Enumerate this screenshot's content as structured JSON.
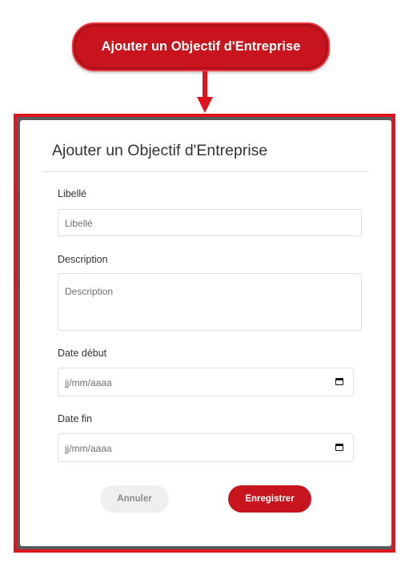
{
  "callout": {
    "label": "Ajouter un Objectif d'Entreprise"
  },
  "modal": {
    "title": "Ajouter un Objectif d'Entreprise",
    "fields": {
      "libelle": {
        "label": "Libellé",
        "placeholder": "Libellé"
      },
      "description": {
        "label": "Description",
        "placeholder": "Description"
      },
      "date_debut": {
        "label": "Date début",
        "value": "jj/mm/aaaa",
        "icon": "calendar-icon"
      },
      "date_fin": {
        "label": "Date fin",
        "value": "jj/mm/aaaa",
        "icon": "calendar-icon"
      }
    },
    "buttons": {
      "cancel": "Annuler",
      "save": "Enregistrer"
    }
  },
  "colors": {
    "accent": "#c8151d",
    "highlight": "#e0141e",
    "backdrop": "#5a5a5a"
  }
}
